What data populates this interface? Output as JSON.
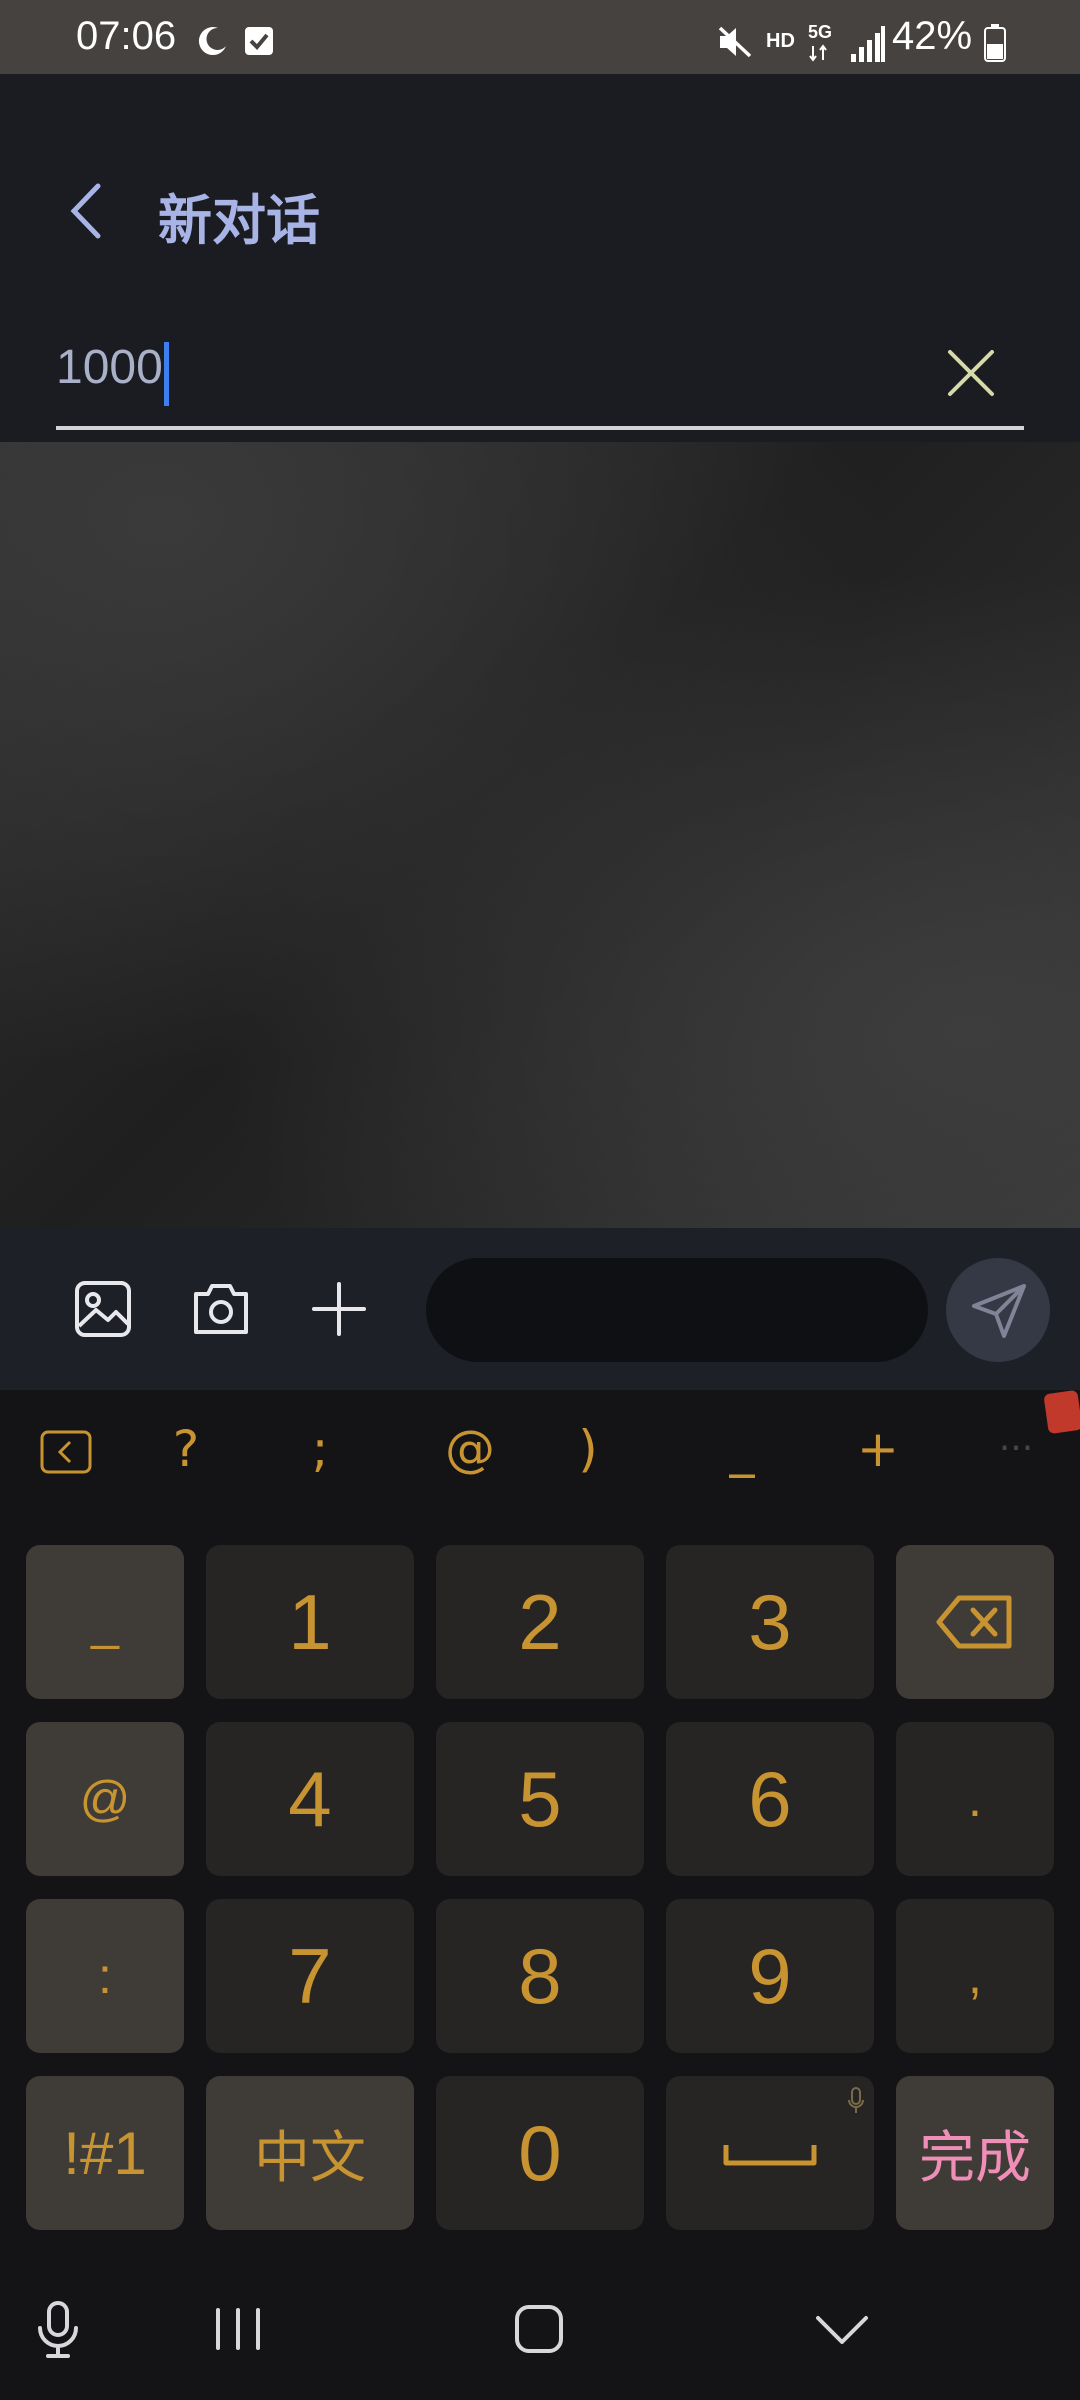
{
  "status_bar": {
    "time": "07:06",
    "battery": "42%",
    "icons": [
      "moon-icon",
      "checkbox-notification-icon",
      "mute-icon",
      "hd-icon",
      "5g-icon",
      "signal-icon",
      "battery-icon"
    ],
    "hd_label": "HD",
    "network_label": "5G"
  },
  "header": {
    "title": "新对话",
    "back_icon": "chevron-left-icon"
  },
  "recipient": {
    "value": "1000",
    "clear_icon": "close-icon"
  },
  "composer": {
    "icons": [
      "gallery-icon",
      "camera-icon",
      "plus-icon"
    ],
    "input_value": "",
    "send_icon": "send-icon"
  },
  "keyboard": {
    "symbol_row": [
      "?",
      ";",
      "@",
      ")",
      "_",
      "+",
      "···"
    ],
    "rows": [
      {
        "left": "_",
        "keys": [
          "1",
          "2",
          "3"
        ]
      },
      {
        "left": "@",
        "keys": [
          "4",
          "5",
          "6"
        ],
        "right": "."
      },
      {
        "left": ":",
        "keys": [
          "7",
          "8",
          "9"
        ],
        "right": ","
      }
    ],
    "bottom": {
      "sym": "!#1",
      "lang": "中文",
      "zero": "0",
      "done": "完成"
    }
  },
  "colors": {
    "accent": "#c89331",
    "title": "#a9b4e6",
    "done": "#f08eb8"
  }
}
